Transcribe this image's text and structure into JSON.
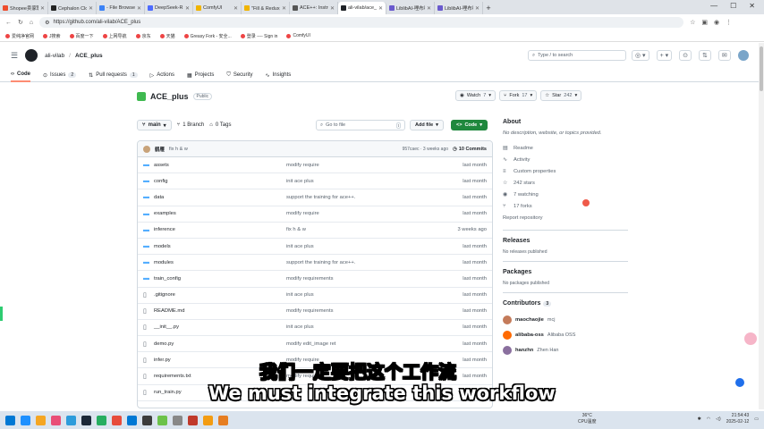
{
  "browser": {
    "tabs": [
      {
        "label": "Shopee卖家聊天室",
        "color": "#ee4d2d"
      },
      {
        "label": "Cephalon Cloud 端",
        "color": "#222222"
      },
      {
        "label": "- File Browser",
        "color": "#3b82f6"
      },
      {
        "label": "DeepSeek-R1-Distil",
        "color": "#4d6bfe"
      },
      {
        "label": "ComfyUI",
        "color": "#f0b400"
      },
      {
        "label": "\"Fill & Redux万物迁",
        "color": "#f0b400"
      },
      {
        "label": "ACE++: Instructio",
        "color": "#555555"
      },
      {
        "label": "ali-vilab/ace_plus",
        "color": "#1f2328",
        "active": true
      },
      {
        "label": "LiblibAI-哩布哩布AI",
        "color": "#6a5acd"
      },
      {
        "label": "LiblibAI-哩布哩布AI",
        "color": "#6a5acd"
      }
    ],
    "url": "https://github.com/ali-vilab/ACE_plus",
    "bookmarks": [
      "爱纯净官网",
      "J搜索",
      "百度一下",
      "上网导航",
      "京东",
      "天猫",
      "Greasy Fork - 安全...",
      "登录 ---- Sign in",
      "ComfyUI"
    ]
  },
  "github": {
    "owner": "ali-vilab",
    "repo": "ACE_plus",
    "search_placeholder": "Type / to search",
    "tabs": [
      {
        "label": "Code",
        "count": ""
      },
      {
        "label": "Issues",
        "count": "2"
      },
      {
        "label": "Pull requests",
        "count": "1"
      },
      {
        "label": "Actions",
        "count": ""
      },
      {
        "label": "Projects",
        "count": ""
      },
      {
        "label": "Security",
        "count": ""
      },
      {
        "label": "Insights",
        "count": ""
      }
    ],
    "visibility": "Public",
    "watch": {
      "label": "Watch",
      "count": "7"
    },
    "fork": {
      "label": "Fork",
      "count": "17"
    },
    "star": {
      "label": "Star",
      "count": "242"
    },
    "branch": "main",
    "branches": "1 Branch",
    "tags": "0 Tags",
    "go_to_file": "Go to file",
    "go_to_file_key": "t",
    "add_file": "Add file",
    "code_button": "Code",
    "commit": {
      "author": "鹤雁",
      "message": "fix h & w",
      "hash": "957caec · 3 weeks ago",
      "commits": "10 Commits"
    },
    "files": [
      {
        "name": "assets",
        "type": "dir",
        "message": "modify require",
        "time": "last month"
      },
      {
        "name": "config",
        "type": "dir",
        "message": "init ace plus",
        "time": "last month"
      },
      {
        "name": "data",
        "type": "dir",
        "message": "support the training for ace++.",
        "time": "last month"
      },
      {
        "name": "examples",
        "type": "dir",
        "message": "modify require",
        "time": "last month"
      },
      {
        "name": "inference",
        "type": "dir",
        "message": "fix h & w",
        "time": "3 weeks ago"
      },
      {
        "name": "models",
        "type": "dir",
        "message": "init ace plus",
        "time": "last month"
      },
      {
        "name": "modules",
        "type": "dir",
        "message": "support the training for ace++.",
        "time": "last month"
      },
      {
        "name": "train_config",
        "type": "dir",
        "message": "modify requirements",
        "time": "last month"
      },
      {
        "name": ".gitignore",
        "type": "file",
        "message": "init ace plus",
        "time": "last month"
      },
      {
        "name": "README.md",
        "type": "file",
        "message": "modify requirements",
        "time": "last month"
      },
      {
        "name": "__init__.py",
        "type": "file",
        "message": "init ace plus",
        "time": "last month"
      },
      {
        "name": "demo.py",
        "type": "file",
        "message": "modify edit_image ret",
        "time": "last month"
      },
      {
        "name": "infer.py",
        "type": "file",
        "message": "modify require",
        "time": "last month"
      },
      {
        "name": "requirements.txt",
        "type": "file",
        "message": "modify require",
        "time": "last month"
      },
      {
        "name": "run_train.py",
        "type": "file",
        "message": "",
        "time": "last month"
      }
    ],
    "about": {
      "title": "About",
      "description": "No description, website, or topics provided.",
      "readme": "Readme",
      "activity": "Activity",
      "custom_properties": "Custom properties",
      "stars": "242 stars",
      "watching": "7 watching",
      "forks": "17 forks",
      "report": "Report repository"
    },
    "releases": {
      "title": "Releases",
      "text": "No releases published"
    },
    "packages": {
      "title": "Packages",
      "text": "No packages published"
    },
    "contributors": {
      "title": "Contributors",
      "count": "3",
      "list": [
        {
          "login": "maochaojie",
          "name": "mcj",
          "color": "#c47b5a"
        },
        {
          "login": "alibaba-oss",
          "name": "Alibaba OSS",
          "color": "#ff6a00"
        },
        {
          "login": "hanzhn",
          "name": "Zhen Han",
          "color": "#8a6f9e"
        }
      ]
    }
  },
  "subtitles": {
    "zh": "我们一定要把这个工作流",
    "en": "We must integrate this workflow"
  },
  "taskbar": {
    "weather_temp": "36°C",
    "weather_label": "CPU温度",
    "time": "21:54:43",
    "date": "2025-02-12",
    "app_colors": [
      "#1e90ff",
      "#f5a623",
      "#e94e77",
      "#2d9cdb",
      "#1b2838",
      "#27ae60",
      "#e74c3c",
      "#0078d4",
      "#3c3c3c",
      "#6cc24a",
      "#888888",
      "#c0392b",
      "#f39c12",
      "#e67e22"
    ]
  }
}
